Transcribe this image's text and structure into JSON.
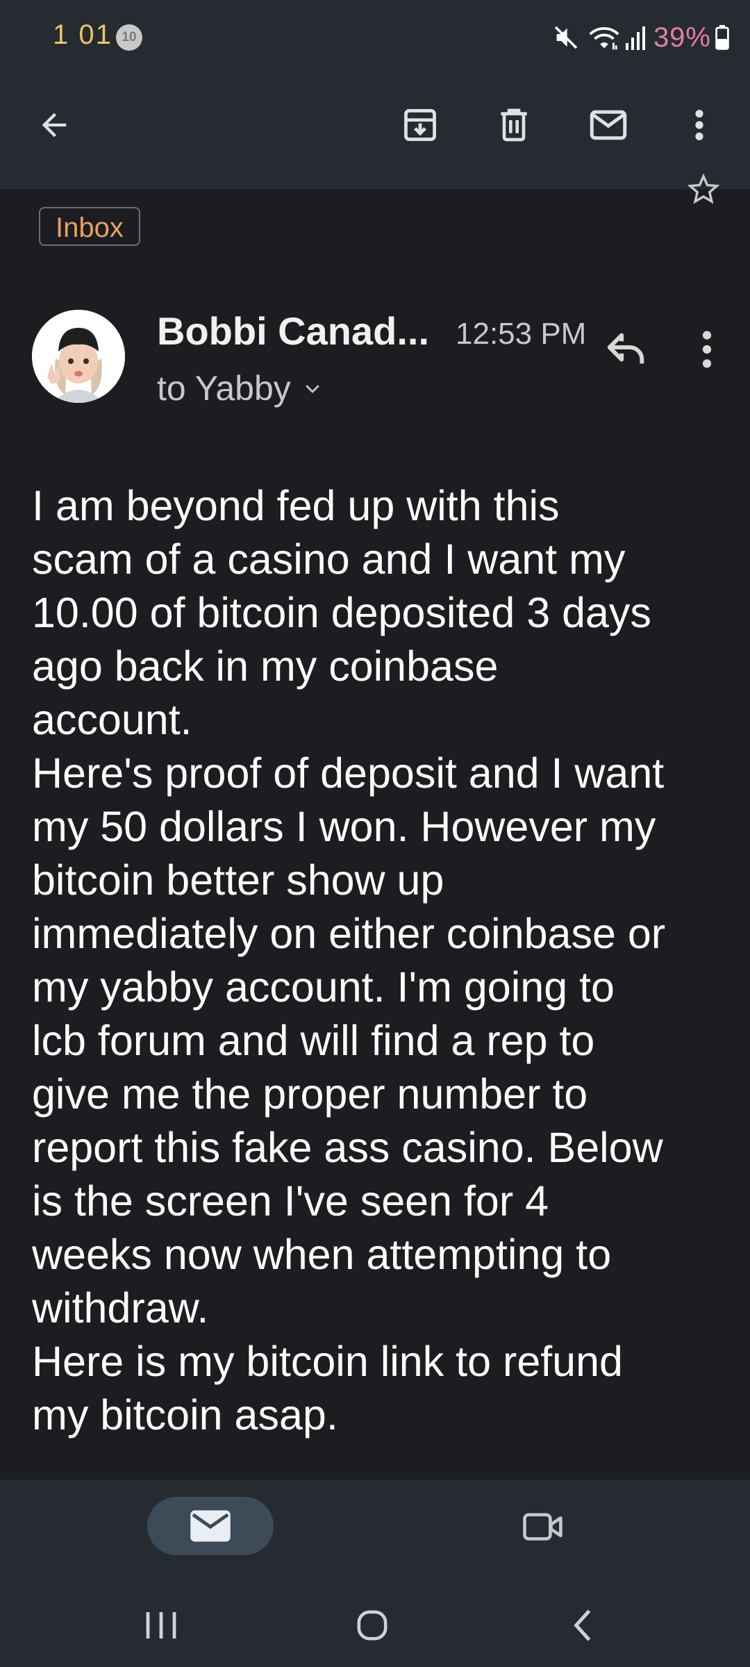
{
  "status_bar": {
    "time": "1 01",
    "notification_count": "10",
    "battery_percent": "39%"
  },
  "app_bar": {
    "icons": [
      "back-arrow-icon",
      "archive-icon",
      "delete-icon",
      "mark-unread-icon",
      "more-vert-icon"
    ]
  },
  "email": {
    "label": "Inbox",
    "sender": "Bobbi Canad...",
    "time": "12:53 PM",
    "recipient": "to Yabby",
    "body": "I am beyond fed up with this\nscam of a casino and I want my\n10.00 of bitcoin deposited 3 days\nago back in my coinbase\naccount.\nHere's proof of deposit and I want\nmy 50 dollars I won. However my\nbitcoin better show up\nimmediately on either coinbase or\nmy yabby account. I'm going to\nlcb forum and will find a rep to\ngive me the proper number to\nreport this fake ass casino. Below\nis the screen I've seen for 4\nweeks now when attempting to\nwithdraw.\nHere is my bitcoin link to refund\nmy bitcoin asap."
  },
  "bottom_nav": {
    "tabs": [
      "mail-icon",
      "video-camera-icon"
    ],
    "active_tab": "mail-icon"
  },
  "system_nav": {
    "buttons": [
      "recents-icon",
      "home-icon",
      "system-back-icon"
    ]
  },
  "colors": {
    "background": "#1b1d20",
    "bar": "#252b31",
    "active_tab": "#3d4a58",
    "text_secondary": "#c6c8cc"
  }
}
